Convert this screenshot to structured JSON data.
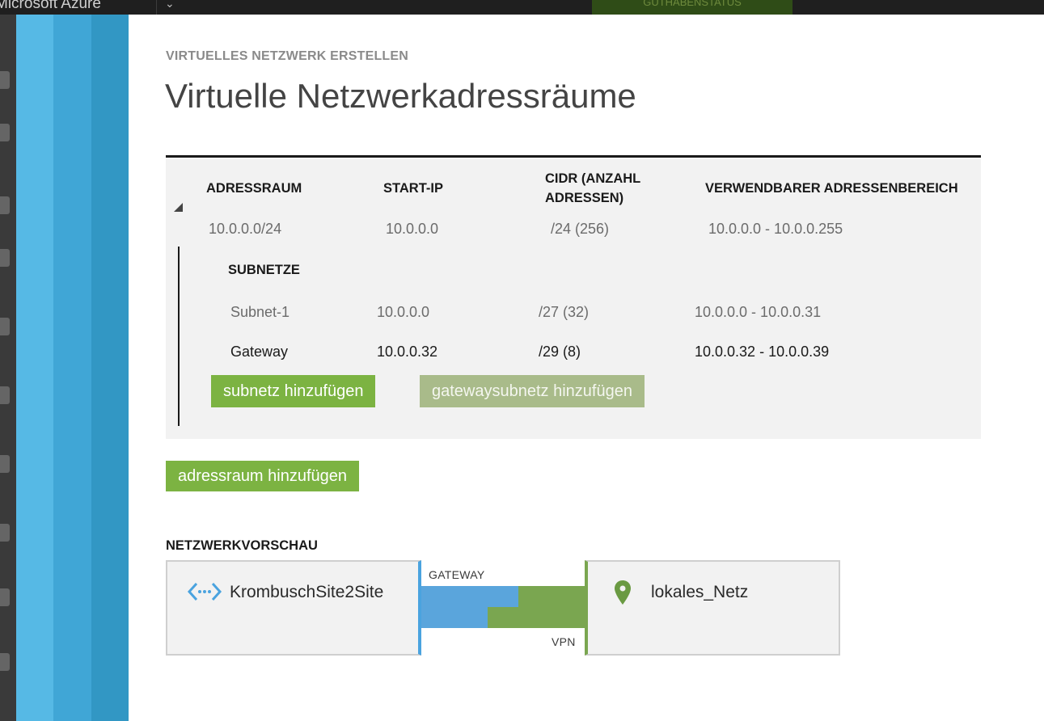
{
  "app": {
    "brand": "Microsoft Azure",
    "credit_status": "GUTHABENSTATUS"
  },
  "wizard": {
    "eyebrow": "VIRTUELLES NETZWERK ERSTELLEN",
    "title": "Virtuelle Netzwerkadressräume"
  },
  "table": {
    "headers": {
      "address_space": "ADRESSRAUM",
      "start_ip": "START-IP",
      "cidr_line1": "CIDR (ANZAHL",
      "cidr_line2": "ADRESSEN)",
      "usable_range": "VERWENDBARER ADRESSENBEREICH"
    },
    "address_space": {
      "name": "10.0.0.0/24",
      "start_ip": "10.0.0.0",
      "cidr": "/24 (256)",
      "range": "10.0.0.0 - 10.0.0.255"
    },
    "subnets_heading": "SUBNETZE",
    "subnets": [
      {
        "name": "Subnet-1",
        "start_ip": "10.0.0.0",
        "cidr": "/27 (32)",
        "range": "10.0.0.0 - 10.0.0.31"
      },
      {
        "name": "Gateway",
        "start_ip": "10.0.0.32",
        "cidr": "/29 (8)",
        "range": "10.0.0.32 - 10.0.0.39"
      }
    ],
    "add_subnet_label": "subnetz hinzufügen",
    "add_gateway_subnet_label": "gatewaysubnetz hinzufügen"
  },
  "add_address_space_label": "adressraum hinzufügen",
  "preview": {
    "heading": "NETZWERKVORSCHAU",
    "vnet_name": "KrombuschSite2Site",
    "gateway_label": "GATEWAY",
    "vpn_label": "VPN",
    "local_network_name": "lokales_Netz"
  },
  "colors": {
    "accent_green": "#7cb342",
    "gateway_blue": "#5aa5dc",
    "vpn_green": "#7aa650",
    "stripe_1": "#56b9e5",
    "stripe_2": "#40a6d6",
    "stripe_3": "#3297c4"
  }
}
